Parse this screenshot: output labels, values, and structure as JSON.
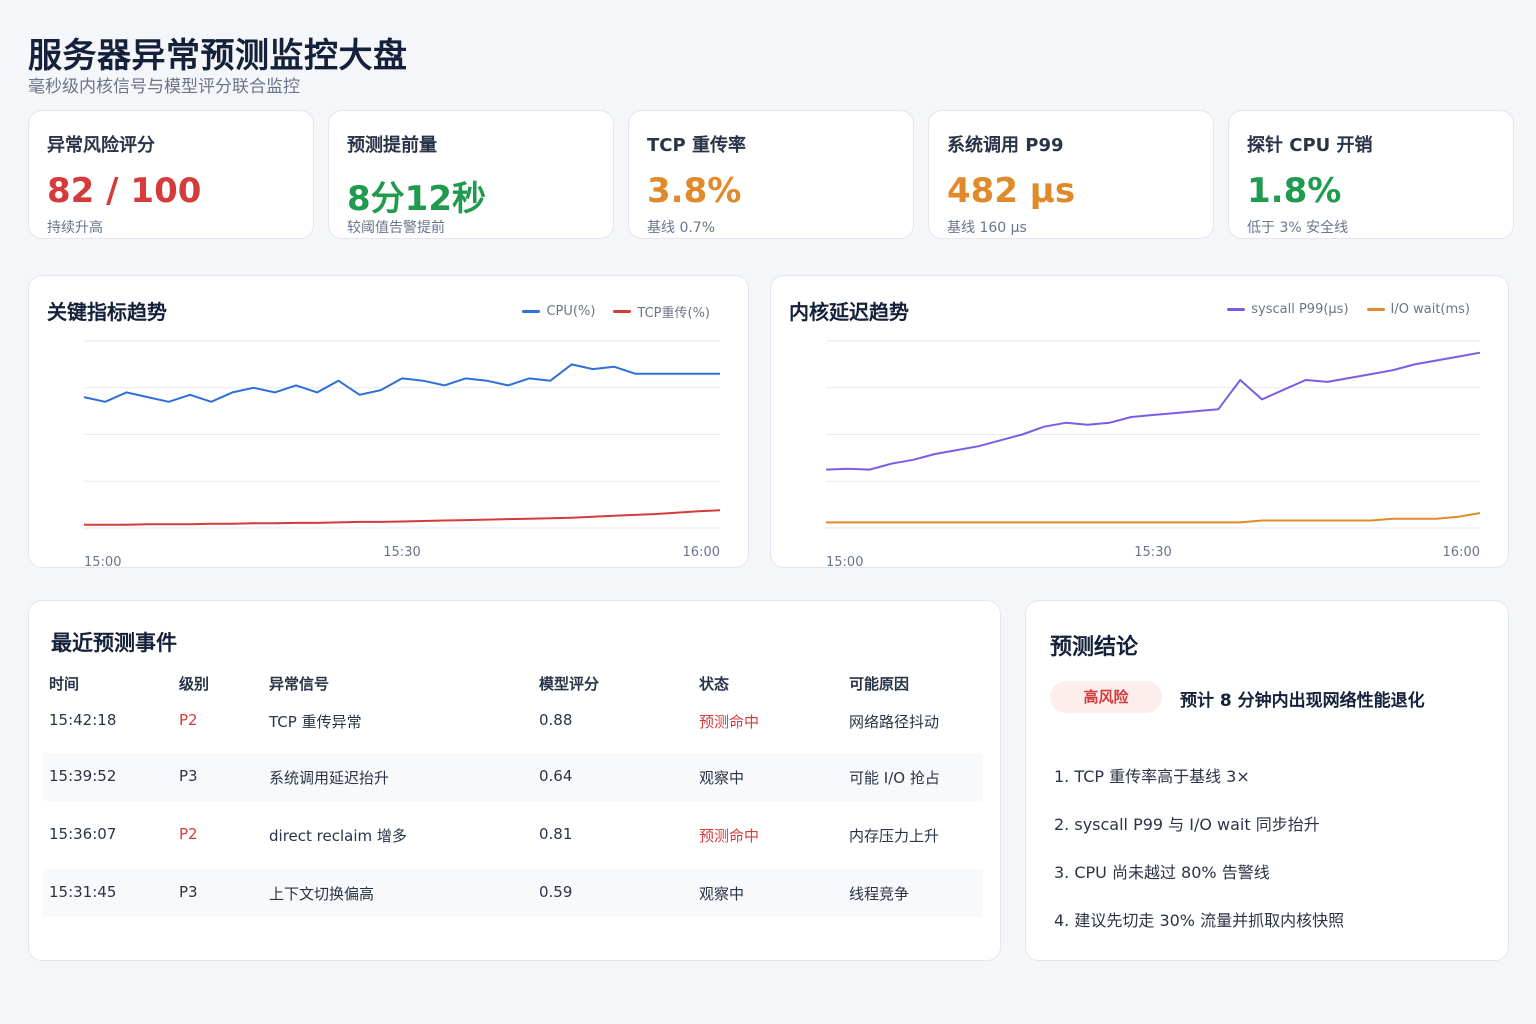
{
  "header": {
    "title": "服务器异常预测监控大盘",
    "subtitle": "毫秒级内核信号与模型评分联合监控"
  },
  "colors": {
    "red": "#d63b3b",
    "green": "#1f9a4e",
    "orange": "#e08a2b",
    "blue": "#2e6fd8",
    "purple": "#7b5ce6"
  },
  "kpis": [
    {
      "title": "异常风险评分",
      "value": "82 / 100",
      "note": "持续升高",
      "color": "#d63b3b"
    },
    {
      "title": "预测提前量",
      "value": "8分12秒",
      "note": "较阈值告警提前",
      "color": "#1f9a4e"
    },
    {
      "title": "TCP 重传率",
      "value": "3.8%",
      "note": "基线 0.7%",
      "color": "#e08a2b"
    },
    {
      "title": "系统调用 P99",
      "value": "482 µs",
      "note": "基线 160 µs",
      "color": "#e08a2b"
    },
    {
      "title": "探针 CPU 开销",
      "value": "1.8%",
      "note": "低于 3% 安全线",
      "color": "#1f9a4e"
    }
  ],
  "chart_data": [
    {
      "type": "line",
      "title": "关键指标趋势",
      "x": [
        "15:00",
        "15:02",
        "15:04",
        "15:06",
        "15:08",
        "15:10",
        "15:12",
        "15:14",
        "15:16",
        "15:18",
        "15:20",
        "15:22",
        "15:24",
        "15:26",
        "15:28",
        "15:30",
        "15:32",
        "15:34",
        "15:36",
        "15:38",
        "15:40",
        "15:42",
        "15:44",
        "15:46",
        "15:48",
        "15:50",
        "15:52",
        "15:54",
        "15:56",
        "15:58",
        "16:00"
      ],
      "x_tick_labels": [
        "15:00",
        "15:30",
        "16:00"
      ],
      "series": [
        {
          "name": "CPU(%)",
          "color": "#2e6fd8",
          "values": [
            56,
            54,
            58,
            56,
            54,
            57,
            54,
            58,
            60,
            58,
            61,
            58,
            63,
            57,
            59,
            64,
            63,
            61,
            64,
            63,
            61,
            64,
            63,
            70,
            68,
            69,
            66,
            66,
            66,
            66,
            66
          ]
        },
        {
          "name": "TCP重传(%)",
          "color": "#d63b3b",
          "values": [
            0.7,
            0.7,
            0.7,
            0.8,
            0.8,
            0.8,
            0.9,
            0.9,
            1.0,
            1.0,
            1.1,
            1.1,
            1.2,
            1.3,
            1.3,
            1.4,
            1.5,
            1.6,
            1.7,
            1.8,
            1.9,
            2.0,
            2.1,
            2.2,
            2.4,
            2.6,
            2.8,
            3.0,
            3.3,
            3.6,
            3.8
          ]
        }
      ],
      "grid": true,
      "legend": "top-right"
    },
    {
      "type": "line",
      "title": "内核延迟趋势",
      "x": [
        "15:00",
        "15:02",
        "15:04",
        "15:06",
        "15:08",
        "15:10",
        "15:12",
        "15:14",
        "15:16",
        "15:18",
        "15:20",
        "15:22",
        "15:24",
        "15:26",
        "15:28",
        "15:30",
        "15:32",
        "15:34",
        "15:36",
        "15:38",
        "15:40",
        "15:42",
        "15:44",
        "15:46",
        "15:48",
        "15:50",
        "15:52",
        "15:54",
        "15:56",
        "15:58",
        "16:00"
      ],
      "x_tick_labels": [
        "15:00",
        "15:30",
        "16:00"
      ],
      "series": [
        {
          "name": "syscall P99(µs)",
          "color": "#7b5ce6",
          "values": [
            150,
            152,
            150,
            165,
            175,
            190,
            200,
            210,
            225,
            240,
            260,
            270,
            265,
            270,
            285,
            290,
            295,
            300,
            305,
            380,
            330,
            355,
            380,
            375,
            385,
            395,
            405,
            420,
            430,
            440,
            450
          ]
        },
        {
          "name": "I/O wait(ms)",
          "color": "#e08a2b",
          "values": [
            3,
            3,
            3,
            3,
            3,
            3,
            3,
            3,
            3,
            3,
            3,
            3,
            3,
            3,
            3,
            3,
            3,
            3,
            3,
            3,
            4,
            4,
            4,
            4,
            4,
            4,
            5,
            5,
            5,
            6,
            8
          ]
        }
      ],
      "grid": true,
      "legend": "top-right"
    }
  ],
  "events": {
    "title": "最近预测事件",
    "columns": [
      "时间",
      "级别",
      "异常信号",
      "模型评分",
      "状态",
      "可能原因"
    ],
    "rows": [
      {
        "time": "15:42:18",
        "level": "P2",
        "signal": "TCP 重传异常",
        "score": "0.88",
        "status": "预测命中",
        "cause": "网络路径抖动",
        "highlight": true
      },
      {
        "time": "15:39:52",
        "level": "P3",
        "signal": "系统调用延迟抬升",
        "score": "0.64",
        "status": "观察中",
        "cause": "可能 I/O 抢占",
        "highlight": false
      },
      {
        "time": "15:36:07",
        "level": "P2",
        "signal": "direct reclaim 增多",
        "score": "0.81",
        "status": "预测命中",
        "cause": "内存压力上升",
        "highlight": true
      },
      {
        "time": "15:31:45",
        "level": "P3",
        "signal": "上下文切换偏高",
        "score": "0.59",
        "status": "观察中",
        "cause": "线程竞争",
        "highlight": false
      }
    ]
  },
  "conclusion": {
    "title": "预测结论",
    "badge": "高风险",
    "headline": "预计 8 分钟内出现网络性能退化",
    "findings": [
      "1. TCP 重传率高于基线 3×",
      "2. syscall P99 与 I/O wait 同步抬升",
      "3. CPU 尚未越过 80% 告警线",
      "4. 建议先切走 30% 流量并抓取内核快照"
    ]
  }
}
